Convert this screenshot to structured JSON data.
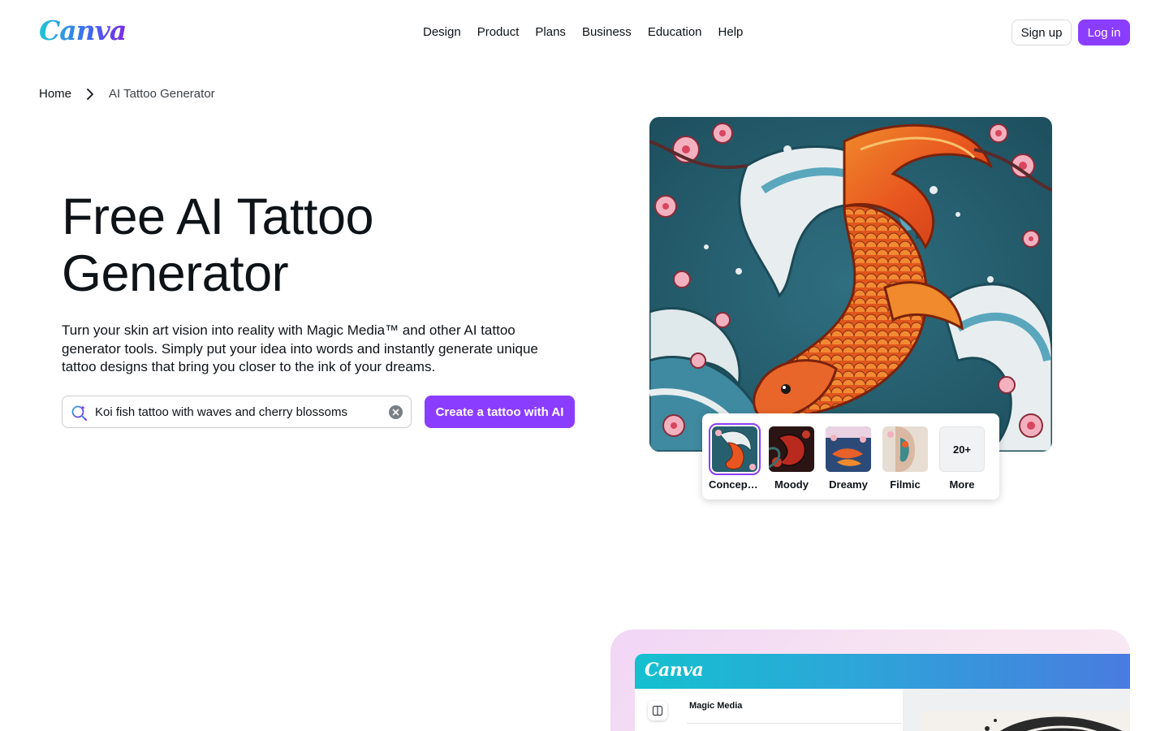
{
  "header": {
    "logo": "Canva",
    "nav": [
      "Design",
      "Product",
      "Plans",
      "Business",
      "Education",
      "Help"
    ],
    "signup_label": "Sign up",
    "login_label": "Log in"
  },
  "breadcrumb": {
    "home": "Home",
    "current": "AI Tattoo Generator"
  },
  "hero": {
    "title_line1": "Free AI Tattoo",
    "title_line2": "Generator",
    "description": "Turn your skin art vision into reality with Magic Media™ and other AI tattoo generator tools. Simply put your idea into words and instantly generate unique tattoo designs that bring you closer to the ink of your dreams.",
    "search_value": "Koi fish tattoo with waves and cherry blossoms",
    "cta_label": "Create a tattoo with AI"
  },
  "styles": {
    "items": [
      {
        "label": "Concept ...",
        "selected": true
      },
      {
        "label": "Moody",
        "selected": false
      },
      {
        "label": "Dreamy",
        "selected": false
      },
      {
        "label": "Filmic",
        "selected": false
      }
    ],
    "more_count": "20+",
    "more_label": "More"
  },
  "preview": {
    "logo": "Canva",
    "panel_title": "Magic Media"
  },
  "colors": {
    "accent": "#8b3dff",
    "text": "#0e1318"
  },
  "icons": [
    "search-sparkle-icon",
    "clear-icon",
    "chevron-right-icon",
    "panel-icon"
  ]
}
